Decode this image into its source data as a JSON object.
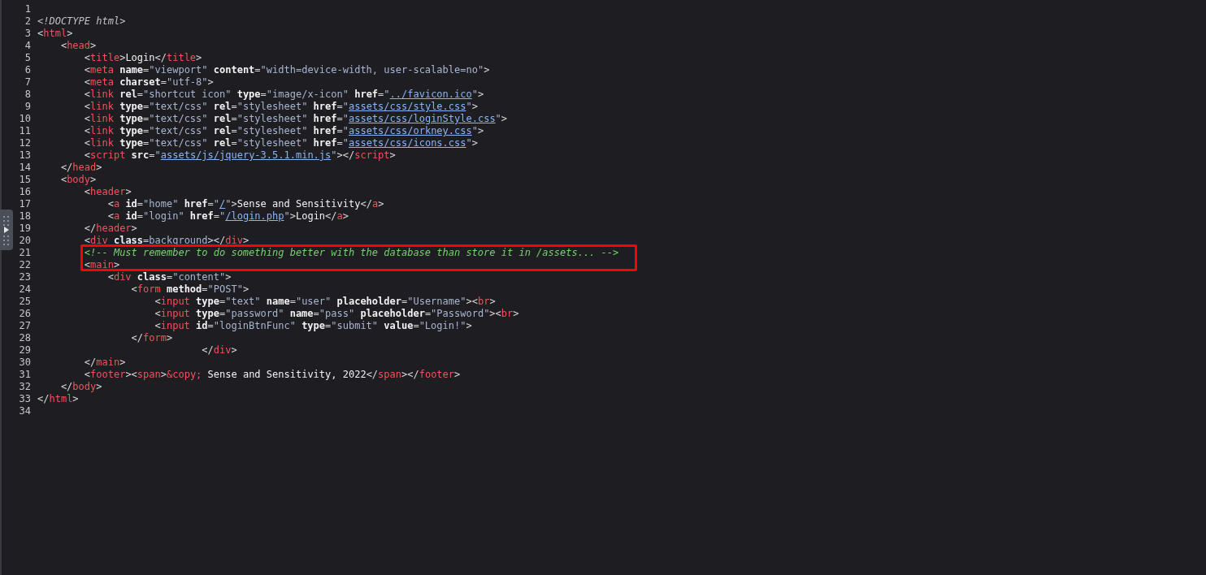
{
  "source_lines": [
    {
      "number": "1"
    },
    {
      "number": "2",
      "tokens": [
        {
          "kind": "doctype",
          "text": "<!DOCTYPE html>"
        }
      ]
    },
    {
      "number": "3",
      "tokens": [
        {
          "kind": "punct",
          "text": "<"
        },
        {
          "kind": "tag",
          "text": "html"
        },
        {
          "kind": "punct",
          "text": ">"
        }
      ]
    },
    {
      "number": "4",
      "tokens": [
        {
          "kind": "punct",
          "text": "    <"
        },
        {
          "kind": "tag",
          "text": "head"
        },
        {
          "kind": "punct",
          "text": ">"
        }
      ]
    },
    {
      "number": "5",
      "tokens": [
        {
          "kind": "punct",
          "text": "        <"
        },
        {
          "kind": "tag",
          "text": "title"
        },
        {
          "kind": "punct",
          "text": ">"
        },
        {
          "kind": "text",
          "text": "Login"
        },
        {
          "kind": "punct",
          "text": "</"
        },
        {
          "kind": "tag",
          "text": "title"
        },
        {
          "kind": "punct",
          "text": ">"
        }
      ]
    },
    {
      "number": "6",
      "tokens": [
        {
          "kind": "punct",
          "text": "        <"
        },
        {
          "kind": "tag",
          "text": "meta"
        },
        {
          "kind": "attr",
          "text": "name"
        },
        {
          "kind": "punct",
          "text": "="
        },
        {
          "kind": "value",
          "text": "\"viewport\""
        },
        {
          "kind": "attr",
          "text": "content"
        },
        {
          "kind": "punct",
          "text": "="
        },
        {
          "kind": "value",
          "text": "\"width=device-width, user-scalable=no\""
        },
        {
          "kind": "punct",
          "text": ">"
        }
      ]
    },
    {
      "number": "7",
      "tokens": [
        {
          "kind": "punct",
          "text": "        <"
        },
        {
          "kind": "tag",
          "text": "meta"
        },
        {
          "kind": "attr",
          "text": "charset"
        },
        {
          "kind": "punct",
          "text": "="
        },
        {
          "kind": "value",
          "text": "\"utf-8\""
        },
        {
          "kind": "punct",
          "text": ">"
        }
      ]
    },
    {
      "number": "8",
      "tokens": [
        {
          "kind": "punct",
          "text": "        <"
        },
        {
          "kind": "tag",
          "text": "link"
        },
        {
          "kind": "attr",
          "text": "rel"
        },
        {
          "kind": "punct",
          "text": "="
        },
        {
          "kind": "value",
          "text": "\"shortcut icon\""
        },
        {
          "kind": "attr",
          "text": "type"
        },
        {
          "kind": "punct",
          "text": "="
        },
        {
          "kind": "value",
          "text": "\"image/x-icon\""
        },
        {
          "kind": "attr",
          "text": "href"
        },
        {
          "kind": "punct",
          "text": "="
        },
        {
          "kind": "value",
          "text": "\""
        },
        {
          "kind": "link",
          "text": "../favicon.ico"
        },
        {
          "kind": "value",
          "text": "\""
        },
        {
          "kind": "punct",
          "text": ">"
        }
      ]
    },
    {
      "number": "9",
      "tokens": [
        {
          "kind": "punct",
          "text": "        <"
        },
        {
          "kind": "tag",
          "text": "link"
        },
        {
          "kind": "attr",
          "text": "type"
        },
        {
          "kind": "punct",
          "text": "="
        },
        {
          "kind": "value",
          "text": "\"text/css\""
        },
        {
          "kind": "attr",
          "text": "rel"
        },
        {
          "kind": "punct",
          "text": "="
        },
        {
          "kind": "value",
          "text": "\"stylesheet\""
        },
        {
          "kind": "attr",
          "text": "href"
        },
        {
          "kind": "punct",
          "text": "="
        },
        {
          "kind": "value",
          "text": "\""
        },
        {
          "kind": "link",
          "text": "assets/css/style.css"
        },
        {
          "kind": "value",
          "text": "\""
        },
        {
          "kind": "punct",
          "text": ">"
        }
      ]
    },
    {
      "number": "10",
      "tokens": [
        {
          "kind": "punct",
          "text": "        <"
        },
        {
          "kind": "tag",
          "text": "link"
        },
        {
          "kind": "attr",
          "text": "type"
        },
        {
          "kind": "punct",
          "text": "="
        },
        {
          "kind": "value",
          "text": "\"text/css\""
        },
        {
          "kind": "attr",
          "text": "rel"
        },
        {
          "kind": "punct",
          "text": "="
        },
        {
          "kind": "value",
          "text": "\"stylesheet\""
        },
        {
          "kind": "attr",
          "text": "href"
        },
        {
          "kind": "punct",
          "text": "="
        },
        {
          "kind": "value",
          "text": "\""
        },
        {
          "kind": "link",
          "text": "assets/css/loginStyle.css"
        },
        {
          "kind": "value",
          "text": "\""
        },
        {
          "kind": "punct",
          "text": ">"
        }
      ]
    },
    {
      "number": "11",
      "tokens": [
        {
          "kind": "punct",
          "text": "        <"
        },
        {
          "kind": "tag",
          "text": "link"
        },
        {
          "kind": "attr",
          "text": "type"
        },
        {
          "kind": "punct",
          "text": "="
        },
        {
          "kind": "value",
          "text": "\"text/css\""
        },
        {
          "kind": "attr",
          "text": "rel"
        },
        {
          "kind": "punct",
          "text": "="
        },
        {
          "kind": "value",
          "text": "\"stylesheet\""
        },
        {
          "kind": "attr",
          "text": "href"
        },
        {
          "kind": "punct",
          "text": "="
        },
        {
          "kind": "value",
          "text": "\""
        },
        {
          "kind": "link",
          "text": "assets/css/orkney.css"
        },
        {
          "kind": "value",
          "text": "\""
        },
        {
          "kind": "punct",
          "text": ">"
        }
      ]
    },
    {
      "number": "12",
      "tokens": [
        {
          "kind": "punct",
          "text": "        <"
        },
        {
          "kind": "tag",
          "text": "link"
        },
        {
          "kind": "attr",
          "text": "type"
        },
        {
          "kind": "punct",
          "text": "="
        },
        {
          "kind": "value",
          "text": "\"text/css\""
        },
        {
          "kind": "attr",
          "text": "rel"
        },
        {
          "kind": "punct",
          "text": "="
        },
        {
          "kind": "value",
          "text": "\"stylesheet\""
        },
        {
          "kind": "attr",
          "text": "href"
        },
        {
          "kind": "punct",
          "text": "="
        },
        {
          "kind": "value",
          "text": "\""
        },
        {
          "kind": "link",
          "text": "assets/css/icons.css"
        },
        {
          "kind": "value",
          "text": "\""
        },
        {
          "kind": "punct",
          "text": ">"
        }
      ]
    },
    {
      "number": "13",
      "tokens": [
        {
          "kind": "punct",
          "text": "        <"
        },
        {
          "kind": "tag",
          "text": "script"
        },
        {
          "kind": "attr",
          "text": "src"
        },
        {
          "kind": "punct",
          "text": "="
        },
        {
          "kind": "value",
          "text": "\""
        },
        {
          "kind": "link",
          "text": "assets/js/jquery-3.5.1.min.js"
        },
        {
          "kind": "value",
          "text": "\""
        },
        {
          "kind": "punct",
          "text": "></"
        },
        {
          "kind": "tag",
          "text": "script"
        },
        {
          "kind": "punct",
          "text": ">"
        }
      ]
    },
    {
      "number": "14",
      "tokens": [
        {
          "kind": "punct",
          "text": "    </"
        },
        {
          "kind": "tag",
          "text": "head"
        },
        {
          "kind": "punct",
          "text": ">"
        }
      ]
    },
    {
      "number": "15",
      "tokens": [
        {
          "kind": "punct",
          "text": "    <"
        },
        {
          "kind": "tag",
          "text": "body"
        },
        {
          "kind": "punct",
          "text": ">"
        }
      ]
    },
    {
      "number": "16",
      "tokens": [
        {
          "kind": "punct",
          "text": "        <"
        },
        {
          "kind": "tag",
          "text": "header"
        },
        {
          "kind": "punct",
          "text": ">"
        }
      ]
    },
    {
      "number": "17",
      "tokens": [
        {
          "kind": "punct",
          "text": "            <"
        },
        {
          "kind": "tag",
          "text": "a"
        },
        {
          "kind": "attr",
          "text": "id"
        },
        {
          "kind": "punct",
          "text": "="
        },
        {
          "kind": "value",
          "text": "\"home\""
        },
        {
          "kind": "attr",
          "text": "href"
        },
        {
          "kind": "punct",
          "text": "="
        },
        {
          "kind": "value",
          "text": "\""
        },
        {
          "kind": "link",
          "text": "/"
        },
        {
          "kind": "value",
          "text": "\""
        },
        {
          "kind": "punct",
          "text": ">"
        },
        {
          "kind": "text",
          "text": "Sense and Sensitivity"
        },
        {
          "kind": "punct",
          "text": "</"
        },
        {
          "kind": "tag",
          "text": "a"
        },
        {
          "kind": "punct",
          "text": ">"
        }
      ]
    },
    {
      "number": "18",
      "tokens": [
        {
          "kind": "punct",
          "text": "            <"
        },
        {
          "kind": "tag",
          "text": "a"
        },
        {
          "kind": "attr",
          "text": "id"
        },
        {
          "kind": "punct",
          "text": "="
        },
        {
          "kind": "value",
          "text": "\"login\""
        },
        {
          "kind": "attr",
          "text": "href"
        },
        {
          "kind": "punct",
          "text": "="
        },
        {
          "kind": "value",
          "text": "\""
        },
        {
          "kind": "link",
          "text": "/login.php"
        },
        {
          "kind": "value",
          "text": "\""
        },
        {
          "kind": "punct",
          "text": ">"
        },
        {
          "kind": "text",
          "text": "Login"
        },
        {
          "kind": "punct",
          "text": "</"
        },
        {
          "kind": "tag",
          "text": "a"
        },
        {
          "kind": "punct",
          "text": ">"
        }
      ]
    },
    {
      "number": "19",
      "tokens": [
        {
          "kind": "punct",
          "text": "        </"
        },
        {
          "kind": "tag",
          "text": "header"
        },
        {
          "kind": "punct",
          "text": ">"
        }
      ]
    },
    {
      "number": "20",
      "tokens": [
        {
          "kind": "punct",
          "text": "        <"
        },
        {
          "kind": "tag",
          "text": "div"
        },
        {
          "kind": "attr",
          "text": "class"
        },
        {
          "kind": "punct",
          "text": "="
        },
        {
          "kind": "value",
          "text": "background"
        },
        {
          "kind": "punct",
          "text": "></"
        },
        {
          "kind": "tag",
          "text": "div"
        },
        {
          "kind": "punct",
          "text": ">"
        }
      ]
    },
    {
      "number": "21",
      "tokens": [
        {
          "kind": "comment",
          "text": "        <!-- Must remember to do something better with the database than store it in /assets... -->"
        }
      ]
    },
    {
      "number": "22",
      "tokens": [
        {
          "kind": "punct",
          "text": "        <"
        },
        {
          "kind": "tag",
          "text": "main"
        },
        {
          "kind": "punct",
          "text": ">"
        }
      ]
    },
    {
      "number": "23",
      "tokens": [
        {
          "kind": "punct",
          "text": "            <"
        },
        {
          "kind": "tag",
          "text": "div"
        },
        {
          "kind": "attr",
          "text": "class"
        },
        {
          "kind": "punct",
          "text": "="
        },
        {
          "kind": "value",
          "text": "\"content\""
        },
        {
          "kind": "punct",
          "text": ">"
        }
      ]
    },
    {
      "number": "24",
      "tokens": [
        {
          "kind": "punct",
          "text": "                <"
        },
        {
          "kind": "tag",
          "text": "form"
        },
        {
          "kind": "attr",
          "text": "method"
        },
        {
          "kind": "punct",
          "text": "="
        },
        {
          "kind": "value",
          "text": "\"POST\""
        },
        {
          "kind": "punct",
          "text": ">"
        }
      ]
    },
    {
      "number": "25",
      "tokens": [
        {
          "kind": "punct",
          "text": "                    <"
        },
        {
          "kind": "tag",
          "text": "input"
        },
        {
          "kind": "attr",
          "text": "type"
        },
        {
          "kind": "punct",
          "text": "="
        },
        {
          "kind": "value",
          "text": "\"text\""
        },
        {
          "kind": "attr",
          "text": "name"
        },
        {
          "kind": "punct",
          "text": "="
        },
        {
          "kind": "value",
          "text": "\"user\""
        },
        {
          "kind": "attr",
          "text": "placeholder"
        },
        {
          "kind": "punct",
          "text": "="
        },
        {
          "kind": "value",
          "text": "\"Username\""
        },
        {
          "kind": "punct",
          "text": "><"
        },
        {
          "kind": "tag",
          "text": "br"
        },
        {
          "kind": "punct",
          "text": ">"
        }
      ]
    },
    {
      "number": "26",
      "tokens": [
        {
          "kind": "punct",
          "text": "                    <"
        },
        {
          "kind": "tag",
          "text": "input"
        },
        {
          "kind": "attr",
          "text": "type"
        },
        {
          "kind": "punct",
          "text": "="
        },
        {
          "kind": "value",
          "text": "\"password\""
        },
        {
          "kind": "attr",
          "text": "name"
        },
        {
          "kind": "punct",
          "text": "="
        },
        {
          "kind": "value",
          "text": "\"pass\""
        },
        {
          "kind": "attr",
          "text": "placeholder"
        },
        {
          "kind": "punct",
          "text": "="
        },
        {
          "kind": "value",
          "text": "\"Password\""
        },
        {
          "kind": "punct",
          "text": "><"
        },
        {
          "kind": "tag",
          "text": "br"
        },
        {
          "kind": "punct",
          "text": ">"
        }
      ]
    },
    {
      "number": "27",
      "tokens": [
        {
          "kind": "punct",
          "text": "                    <"
        },
        {
          "kind": "tag",
          "text": "input"
        },
        {
          "kind": "attr",
          "text": "id"
        },
        {
          "kind": "punct",
          "text": "="
        },
        {
          "kind": "value",
          "text": "\"loginBtnFunc\""
        },
        {
          "kind": "attr",
          "text": "type"
        },
        {
          "kind": "punct",
          "text": "="
        },
        {
          "kind": "value",
          "text": "\"submit\""
        },
        {
          "kind": "attr",
          "text": "value"
        },
        {
          "kind": "punct",
          "text": "="
        },
        {
          "kind": "value",
          "text": "\"Login!\""
        },
        {
          "kind": "punct",
          "text": ">"
        }
      ]
    },
    {
      "number": "28",
      "tokens": [
        {
          "kind": "punct",
          "text": "                </"
        },
        {
          "kind": "tag",
          "text": "form"
        },
        {
          "kind": "punct",
          "text": ">"
        }
      ]
    },
    {
      "number": "29",
      "tokens": [
        {
          "kind": "punct",
          "text": "                            </"
        },
        {
          "kind": "tag",
          "text": "div"
        },
        {
          "kind": "punct",
          "text": ">"
        }
      ]
    },
    {
      "number": "30",
      "tokens": [
        {
          "kind": "punct",
          "text": "        </"
        },
        {
          "kind": "tag",
          "text": "main"
        },
        {
          "kind": "punct",
          "text": ">"
        }
      ]
    },
    {
      "number": "31",
      "tokens": [
        {
          "kind": "punct",
          "text": "        <"
        },
        {
          "kind": "tag",
          "text": "footer"
        },
        {
          "kind": "punct",
          "text": "><"
        },
        {
          "kind": "tag",
          "text": "span"
        },
        {
          "kind": "punct",
          "text": ">"
        },
        {
          "kind": "entity",
          "text": "&copy;"
        },
        {
          "kind": "text",
          "text": " Sense and Sensitivity, 2022"
        },
        {
          "kind": "punct",
          "text": "</"
        },
        {
          "kind": "tag",
          "text": "span"
        },
        {
          "kind": "punct",
          "text": "></"
        },
        {
          "kind": "tag",
          "text": "footer"
        },
        {
          "kind": "punct",
          "text": ">"
        }
      ]
    },
    {
      "number": "32",
      "tokens": [
        {
          "kind": "punct",
          "text": "    </"
        },
        {
          "kind": "tag",
          "text": "body"
        },
        {
          "kind": "punct",
          "text": ">"
        }
      ]
    },
    {
      "number": "33",
      "tokens": [
        {
          "kind": "punct",
          "text": "</"
        },
        {
          "kind": "tag",
          "text": "html"
        },
        {
          "kind": "punct",
          "text": ">"
        }
      ]
    },
    {
      "number": "34"
    }
  ]
}
